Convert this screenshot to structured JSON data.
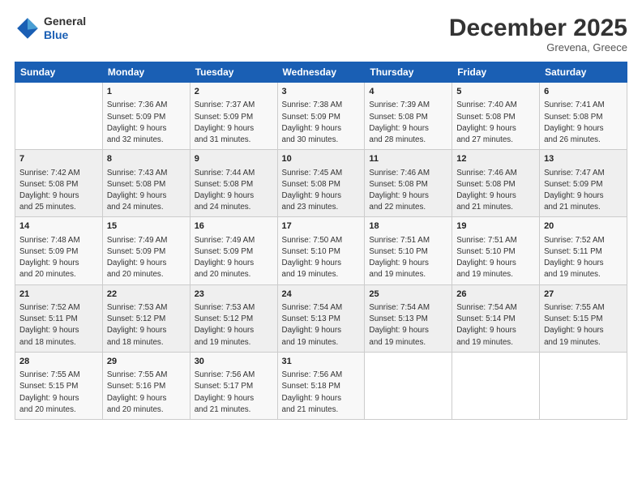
{
  "logo": {
    "line1": "General",
    "line2": "Blue"
  },
  "title": "December 2025",
  "subtitle": "Grevena, Greece",
  "header_days": [
    "Sunday",
    "Monday",
    "Tuesday",
    "Wednesday",
    "Thursday",
    "Friday",
    "Saturday"
  ],
  "weeks": [
    [
      {
        "day": "",
        "info": ""
      },
      {
        "day": "1",
        "info": "Sunrise: 7:36 AM\nSunset: 5:09 PM\nDaylight: 9 hours\nand 32 minutes."
      },
      {
        "day": "2",
        "info": "Sunrise: 7:37 AM\nSunset: 5:09 PM\nDaylight: 9 hours\nand 31 minutes."
      },
      {
        "day": "3",
        "info": "Sunrise: 7:38 AM\nSunset: 5:09 PM\nDaylight: 9 hours\nand 30 minutes."
      },
      {
        "day": "4",
        "info": "Sunrise: 7:39 AM\nSunset: 5:08 PM\nDaylight: 9 hours\nand 28 minutes."
      },
      {
        "day": "5",
        "info": "Sunrise: 7:40 AM\nSunset: 5:08 PM\nDaylight: 9 hours\nand 27 minutes."
      },
      {
        "day": "6",
        "info": "Sunrise: 7:41 AM\nSunset: 5:08 PM\nDaylight: 9 hours\nand 26 minutes."
      }
    ],
    [
      {
        "day": "7",
        "info": "Sunrise: 7:42 AM\nSunset: 5:08 PM\nDaylight: 9 hours\nand 25 minutes."
      },
      {
        "day": "8",
        "info": "Sunrise: 7:43 AM\nSunset: 5:08 PM\nDaylight: 9 hours\nand 24 minutes."
      },
      {
        "day": "9",
        "info": "Sunrise: 7:44 AM\nSunset: 5:08 PM\nDaylight: 9 hours\nand 24 minutes."
      },
      {
        "day": "10",
        "info": "Sunrise: 7:45 AM\nSunset: 5:08 PM\nDaylight: 9 hours\nand 23 minutes."
      },
      {
        "day": "11",
        "info": "Sunrise: 7:46 AM\nSunset: 5:08 PM\nDaylight: 9 hours\nand 22 minutes."
      },
      {
        "day": "12",
        "info": "Sunrise: 7:46 AM\nSunset: 5:08 PM\nDaylight: 9 hours\nand 21 minutes."
      },
      {
        "day": "13",
        "info": "Sunrise: 7:47 AM\nSunset: 5:09 PM\nDaylight: 9 hours\nand 21 minutes."
      }
    ],
    [
      {
        "day": "14",
        "info": "Sunrise: 7:48 AM\nSunset: 5:09 PM\nDaylight: 9 hours\nand 20 minutes."
      },
      {
        "day": "15",
        "info": "Sunrise: 7:49 AM\nSunset: 5:09 PM\nDaylight: 9 hours\nand 20 minutes."
      },
      {
        "day": "16",
        "info": "Sunrise: 7:49 AM\nSunset: 5:09 PM\nDaylight: 9 hours\nand 20 minutes."
      },
      {
        "day": "17",
        "info": "Sunrise: 7:50 AM\nSunset: 5:10 PM\nDaylight: 9 hours\nand 19 minutes."
      },
      {
        "day": "18",
        "info": "Sunrise: 7:51 AM\nSunset: 5:10 PM\nDaylight: 9 hours\nand 19 minutes."
      },
      {
        "day": "19",
        "info": "Sunrise: 7:51 AM\nSunset: 5:10 PM\nDaylight: 9 hours\nand 19 minutes."
      },
      {
        "day": "20",
        "info": "Sunrise: 7:52 AM\nSunset: 5:11 PM\nDaylight: 9 hours\nand 19 minutes."
      }
    ],
    [
      {
        "day": "21",
        "info": "Sunrise: 7:52 AM\nSunset: 5:11 PM\nDaylight: 9 hours\nand 18 minutes."
      },
      {
        "day": "22",
        "info": "Sunrise: 7:53 AM\nSunset: 5:12 PM\nDaylight: 9 hours\nand 18 minutes."
      },
      {
        "day": "23",
        "info": "Sunrise: 7:53 AM\nSunset: 5:12 PM\nDaylight: 9 hours\nand 19 minutes."
      },
      {
        "day": "24",
        "info": "Sunrise: 7:54 AM\nSunset: 5:13 PM\nDaylight: 9 hours\nand 19 minutes."
      },
      {
        "day": "25",
        "info": "Sunrise: 7:54 AM\nSunset: 5:13 PM\nDaylight: 9 hours\nand 19 minutes."
      },
      {
        "day": "26",
        "info": "Sunrise: 7:54 AM\nSunset: 5:14 PM\nDaylight: 9 hours\nand 19 minutes."
      },
      {
        "day": "27",
        "info": "Sunrise: 7:55 AM\nSunset: 5:15 PM\nDaylight: 9 hours\nand 19 minutes."
      }
    ],
    [
      {
        "day": "28",
        "info": "Sunrise: 7:55 AM\nSunset: 5:15 PM\nDaylight: 9 hours\nand 20 minutes."
      },
      {
        "day": "29",
        "info": "Sunrise: 7:55 AM\nSunset: 5:16 PM\nDaylight: 9 hours\nand 20 minutes."
      },
      {
        "day": "30",
        "info": "Sunrise: 7:56 AM\nSunset: 5:17 PM\nDaylight: 9 hours\nand 21 minutes."
      },
      {
        "day": "31",
        "info": "Sunrise: 7:56 AM\nSunset: 5:18 PM\nDaylight: 9 hours\nand 21 minutes."
      },
      {
        "day": "",
        "info": ""
      },
      {
        "day": "",
        "info": ""
      },
      {
        "day": "",
        "info": ""
      }
    ]
  ]
}
